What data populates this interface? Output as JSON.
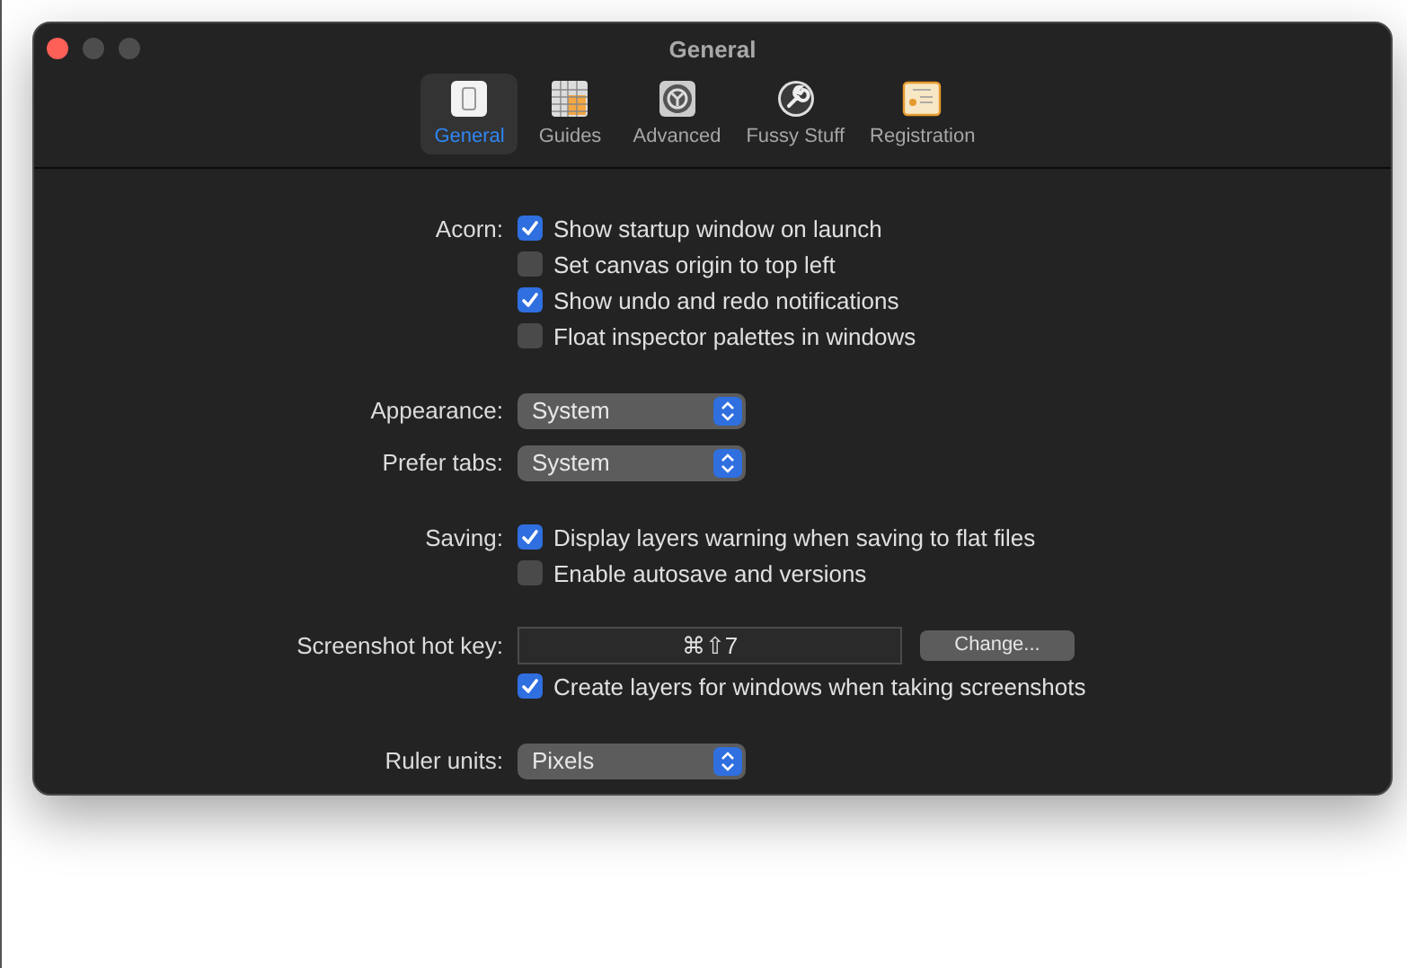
{
  "window": {
    "title": "General"
  },
  "tabs": [
    {
      "label": "General",
      "kind": "general",
      "selected": true
    },
    {
      "label": "Guides",
      "kind": "guides",
      "selected": false
    },
    {
      "label": "Advanced",
      "kind": "advanced",
      "selected": false
    },
    {
      "label": "Fussy Stuff",
      "kind": "fussy",
      "selected": false
    },
    {
      "label": "Registration",
      "kind": "registration",
      "selected": false
    }
  ],
  "groups": [
    {
      "rows": [
        {
          "label": "Acorn:",
          "kind": "checkbox",
          "text": "Show startup window on launch",
          "checked": true
        },
        {
          "kind": "checkbox",
          "text": "Set canvas origin to top left",
          "checked": false
        },
        {
          "kind": "checkbox",
          "text": "Show undo and redo notifications",
          "checked": true
        },
        {
          "kind": "checkbox",
          "text": "Float inspector palettes in windows",
          "checked": false
        }
      ]
    },
    {
      "rows": [
        {
          "label": "Appearance:",
          "kind": "select",
          "value": "System"
        },
        {
          "label": "Prefer tabs:",
          "kind": "select",
          "value": "System"
        }
      ]
    },
    {
      "rows": [
        {
          "label": "Saving:",
          "kind": "checkbox",
          "text": "Display layers warning when saving to flat files",
          "checked": true
        },
        {
          "kind": "checkbox",
          "text": "Enable autosave and versions",
          "checked": false
        }
      ]
    },
    {
      "rows": [
        {
          "label": "Screenshot hot key:",
          "kind": "hotkey",
          "value": "⌘⇧7",
          "button": "Change..."
        },
        {
          "kind": "checkbox",
          "text": "Create layers for windows when taking screenshots",
          "checked": true
        }
      ]
    },
    {
      "rows": [
        {
          "label": "Ruler units:",
          "kind": "select",
          "value": "Pixels"
        }
      ]
    }
  ]
}
